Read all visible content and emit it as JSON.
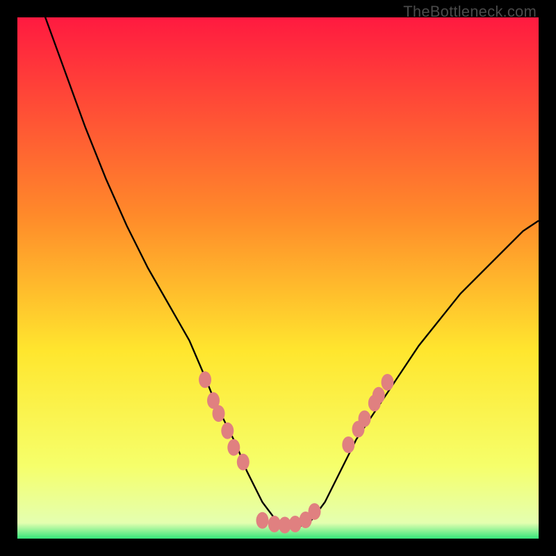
{
  "watermark": "TheBottleneck.com",
  "colors": {
    "frame": "#000000",
    "gradient_top": "#ff1a40",
    "gradient_mid1": "#ff8a2a",
    "gradient_mid2": "#ffe62e",
    "gradient_mid3": "#f6ff6a",
    "gradient_bottom": "#35e67a",
    "curve": "#000000",
    "marker_fill": "#e08080",
    "marker_stroke": "#b85a5a"
  },
  "chart_data": {
    "type": "line",
    "title": "",
    "xlabel": "",
    "ylabel": "",
    "xlim": [
      0,
      100
    ],
    "ylim": [
      0,
      100
    ],
    "grid": false,
    "legend": false,
    "series": [
      {
        "name": "curve",
        "x": [
          5,
          9,
          13,
          17,
          21,
          25,
          29,
          33,
          36,
          38,
          40,
          42,
          44,
          47,
          50,
          53,
          56,
          59,
          62,
          65,
          69,
          73,
          77,
          81,
          85,
          89,
          93,
          97,
          100
        ],
        "y": [
          101,
          90,
          79,
          69,
          60,
          52,
          45,
          38,
          31,
          26,
          22,
          18,
          13,
          7,
          3,
          2,
          3,
          7,
          13,
          19,
          25,
          31,
          37,
          42,
          47,
          51,
          55,
          59,
          61
        ]
      }
    ],
    "markers": {
      "left_cluster": [
        {
          "x": 36.0,
          "y": 30.5
        },
        {
          "x": 37.6,
          "y": 26.5
        },
        {
          "x": 38.6,
          "y": 24.0
        },
        {
          "x": 40.3,
          "y": 20.7
        },
        {
          "x": 41.5,
          "y": 17.5
        },
        {
          "x": 43.3,
          "y": 14.7
        }
      ],
      "bottom_cluster": [
        {
          "x": 47.0,
          "y": 3.5
        },
        {
          "x": 49.3,
          "y": 2.8
        },
        {
          "x": 51.3,
          "y": 2.6
        },
        {
          "x": 53.3,
          "y": 2.8
        },
        {
          "x": 55.3,
          "y": 3.6
        },
        {
          "x": 57.0,
          "y": 5.2
        }
      ],
      "right_cluster": [
        {
          "x": 63.5,
          "y": 18.0
        },
        {
          "x": 65.4,
          "y": 21.0
        },
        {
          "x": 66.6,
          "y": 23.0
        },
        {
          "x": 68.5,
          "y": 26.0
        },
        {
          "x": 69.3,
          "y": 27.5
        },
        {
          "x": 71.0,
          "y": 30.0
        }
      ]
    }
  }
}
